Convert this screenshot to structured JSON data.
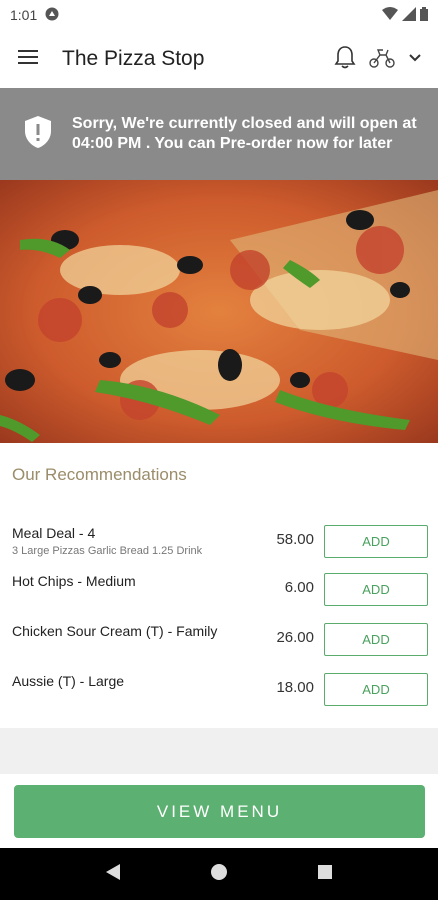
{
  "status_bar": {
    "time": "1:01"
  },
  "app_bar": {
    "title": "The Pizza Stop"
  },
  "banner": {
    "message": "Sorry, We're currently closed and will open at 04:00 PM . You can Pre-order now for later"
  },
  "recommendations": {
    "heading": "Our Recommendations",
    "items": [
      {
        "name": "Meal Deal - 4",
        "description": "3 Large Pizzas Garlic Bread 1.25 Drink",
        "price": "58.00",
        "button": "ADD"
      },
      {
        "name": "Hot Chips - Medium",
        "description": "",
        "price": "6.00",
        "button": "ADD"
      },
      {
        "name": "Chicken Sour Cream (T) - Family",
        "description": "",
        "price": "26.00",
        "button": "ADD"
      },
      {
        "name": "Aussie (T) - Large",
        "description": "",
        "price": "18.00",
        "button": "ADD"
      }
    ]
  },
  "view_menu": {
    "label": "VIEW MENU"
  },
  "colors": {
    "accent": "#5cb071",
    "banner": "#8a8a8a",
    "heading": "#9b8c6a"
  }
}
